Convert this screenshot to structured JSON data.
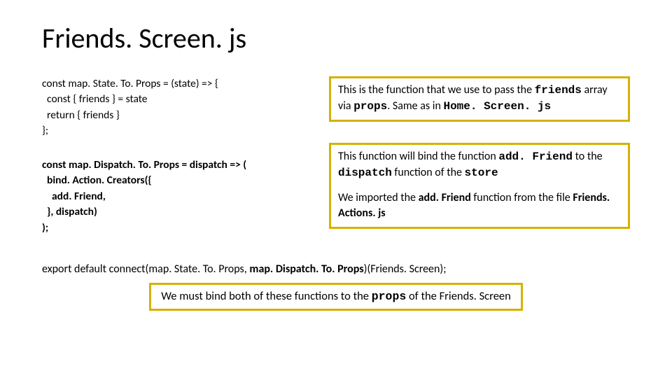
{
  "title": "Friends. Screen. js",
  "code": {
    "mapState": "const map. State. To. Props = (state) => {\n  const { friends } = state\n  return { friends }\n};",
    "mapDispatch": "const map. Dispatch. To. Props = dispatch => (\n  bind. Action. Creators({\n    add. Friend,\n  }, dispatch)\n);"
  },
  "export": {
    "pre": "export default connect(map. State. To. Props, ",
    "bold": "map. Dispatch. To. Props",
    "post": ")(Friends. Screen);"
  },
  "callout1": {
    "t1": "This is the function that we use to pass the ",
    "m1": "friends",
    "t2": " array via ",
    "m2": "props",
    "t3": ". Same as in ",
    "m3": "Home. Screen. js"
  },
  "callout2a": {
    "t1": "This function will bind the function ",
    "m1": "add. Friend",
    "t2": " to the ",
    "m2": "dispatch",
    "t3": " function of the ",
    "m3": "store"
  },
  "callout2b": {
    "t1": "We imported the ",
    "b1": "add. Friend",
    "t2": " function from the file ",
    "b2": "Friends. Actions. js"
  },
  "bottom": {
    "t1": "We must bind both of these functions to the ",
    "m1": "props",
    "t2": " of the Friends. Screen"
  }
}
